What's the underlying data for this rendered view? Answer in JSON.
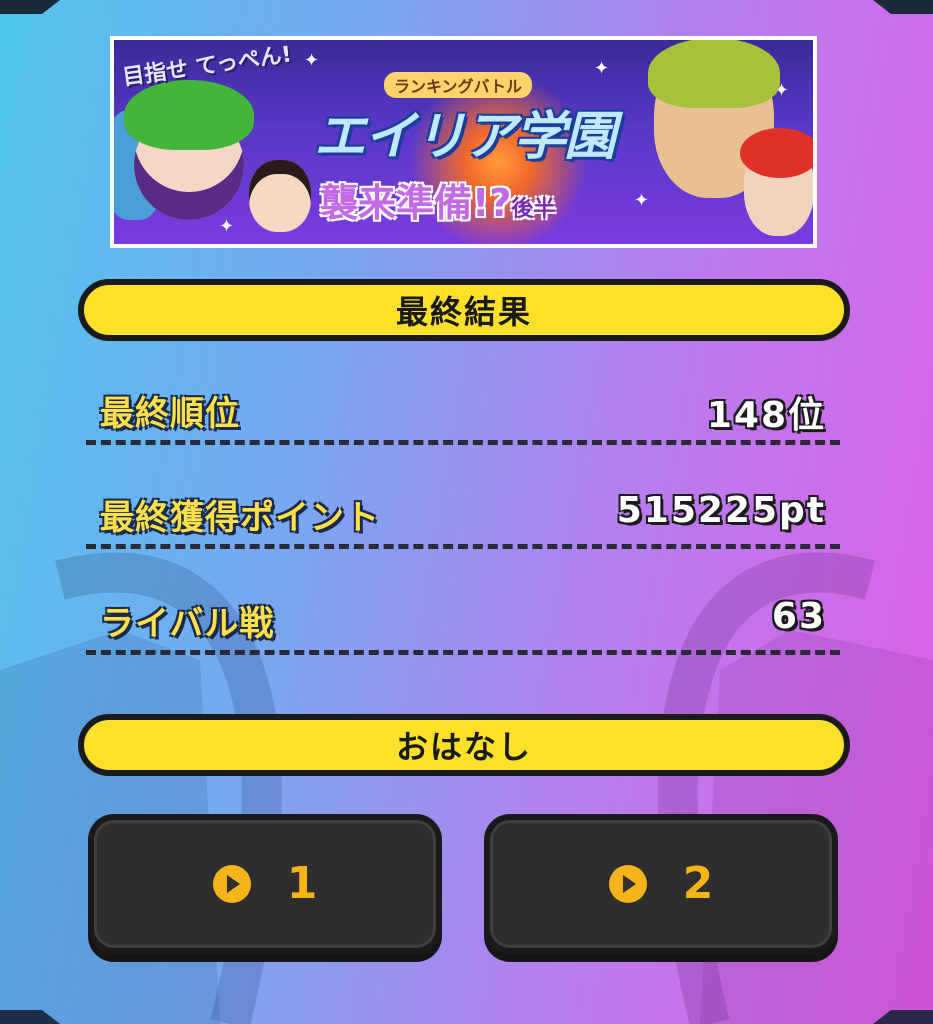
{
  "banner": {
    "tagline": "目指せ てっぺん!",
    "category": "ランキングバトル",
    "title": "エイリア学園",
    "subtitle": "襲来準備!?",
    "subtitle_suffix": "後半"
  },
  "results": {
    "header": "最終結果",
    "rows": [
      {
        "label": "最終順位",
        "value": "148位"
      },
      {
        "label": "最終獲得ポイント",
        "value": "515225pt"
      },
      {
        "label": "ライバル戦",
        "value": "63"
      }
    ]
  },
  "story": {
    "header": "おはなし",
    "buttons": [
      {
        "label": "1",
        "icon": "play-icon"
      },
      {
        "label": "2",
        "icon": "play-icon"
      }
    ]
  },
  "colors": {
    "accent_yellow": "#fde02a",
    "button_dark": "#2e2e2e",
    "button_icon": "#f5b51a"
  }
}
